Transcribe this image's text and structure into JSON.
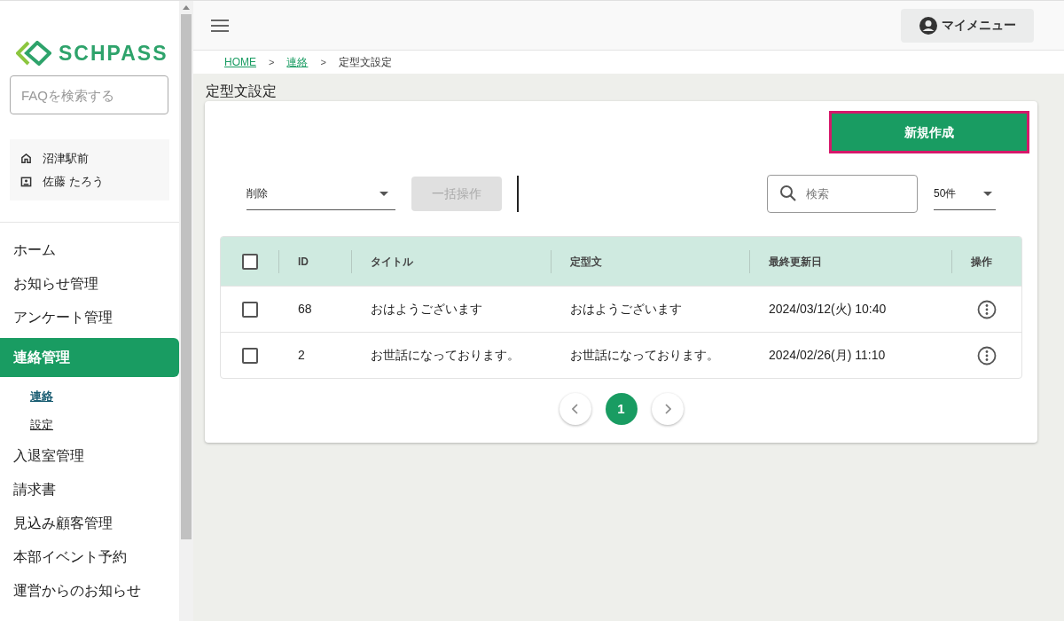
{
  "sidebar": {
    "logo_text": "SCHPASS",
    "faq_search": {
      "placeholder": "FAQを検索する"
    },
    "school": "沼津駅前",
    "user": "佐藤 たろう",
    "items": [
      {
        "label": "ホーム",
        "selected": false
      },
      {
        "label": "お知らせ管理",
        "selected": false
      },
      {
        "label": "アンケート管理",
        "selected": false
      },
      {
        "label": "連絡管理",
        "selected": true,
        "children": [
          {
            "label": "連絡",
            "selected": true
          },
          {
            "label": "設定",
            "selected": false
          }
        ]
      },
      {
        "label": "入退室管理",
        "selected": false
      },
      {
        "label": "請求書",
        "selected": false
      },
      {
        "label": "見込み顧客管理",
        "selected": false
      },
      {
        "label": "本部イベント予約",
        "selected": false
      },
      {
        "label": "運営からのお知らせ",
        "selected": false
      }
    ]
  },
  "header": {
    "my_menu": "マイメニュー"
  },
  "breadcrumb": [
    {
      "label": "HOME",
      "link": true
    },
    {
      "label": "連絡",
      "link": true
    },
    {
      "label": "定型文設定",
      "link": false
    }
  ],
  "breadcrumb_separator": ">",
  "page_title": "定型文設定",
  "new_button": {
    "label": "新規作成",
    "highlighted": true
  },
  "bulk_select": {
    "value": "削除"
  },
  "bulk_button": {
    "label": "一括操作",
    "disabled": true
  },
  "search": {
    "placeholder": "検索"
  },
  "per_page": {
    "value": "50件"
  },
  "table": {
    "columns": [
      "ID",
      "タイトル",
      "定型文",
      "最終更新日",
      "操作"
    ],
    "header_checked": false,
    "rows": [
      {
        "checked": false,
        "cells": [
          "68",
          "おはようございます",
          "おはようございます",
          "2024/03/12(火) 10:40"
        ]
      },
      {
        "checked": false,
        "cells": [
          "2",
          "お世話になっております。",
          "お世話になっております。",
          "2024/02/26(月) 11:10"
        ]
      }
    ]
  },
  "pagination": {
    "pages": [
      {
        "label": "1",
        "selected": true
      }
    ]
  }
}
